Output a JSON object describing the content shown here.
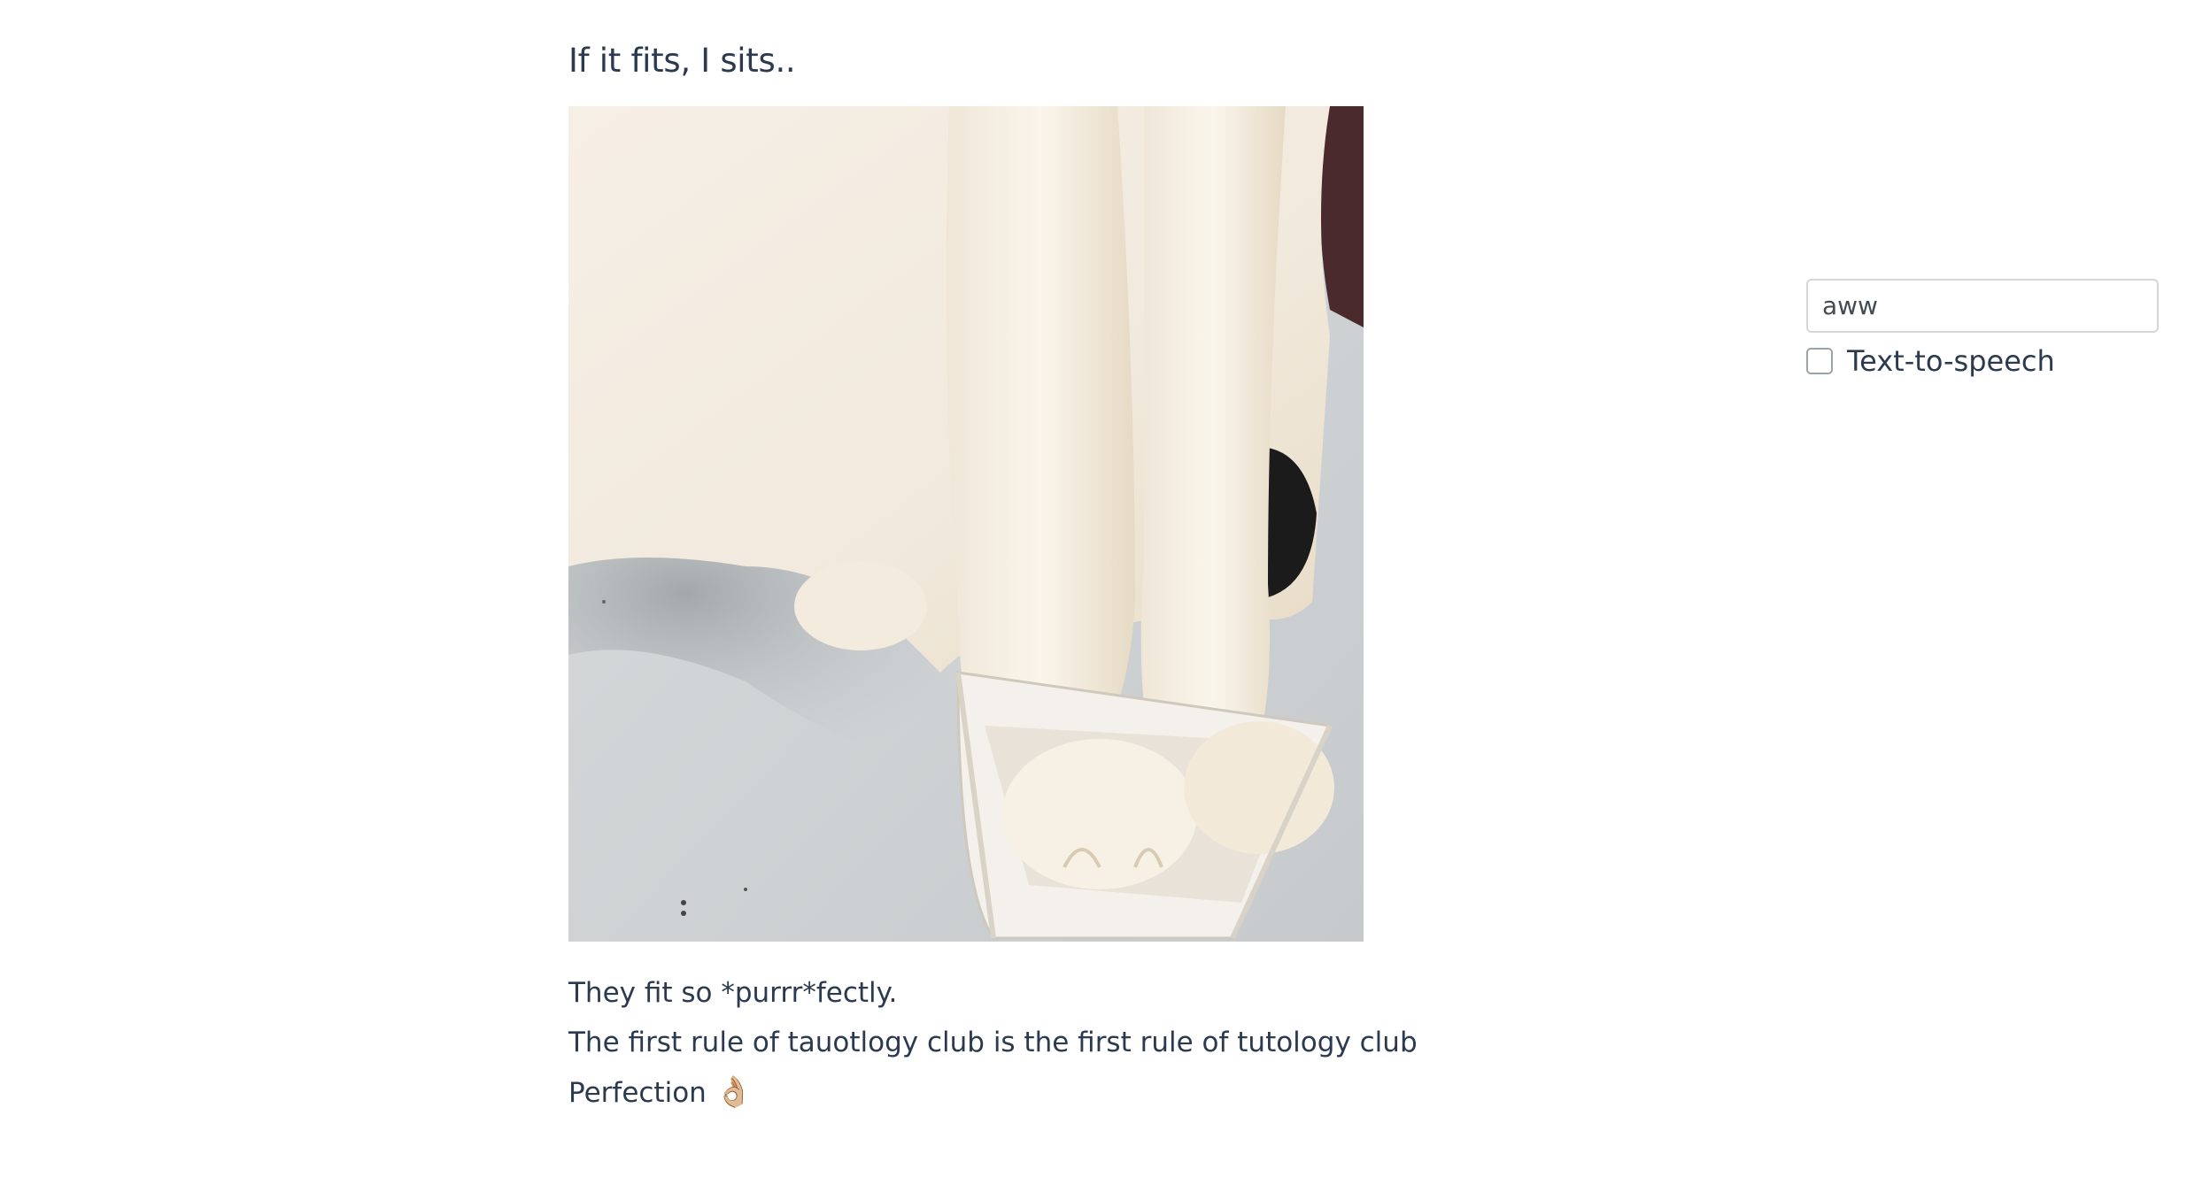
{
  "post": {
    "title": "If it fits, I sits..",
    "image_alt": "White cat with its front paws placed inside a small white box"
  },
  "comments": [
    {
      "text": "They fit so *purrr*fectly.",
      "emoji": ""
    },
    {
      "text": "The first rule of tauotlogy club is the first rule of tutology club",
      "emoji": ""
    },
    {
      "text": "Perfection ",
      "emoji": "👌🏼"
    }
  ],
  "sidebar": {
    "subreddit_value": "aww",
    "tts_label": "Text-to-speech",
    "tts_checked": false
  }
}
